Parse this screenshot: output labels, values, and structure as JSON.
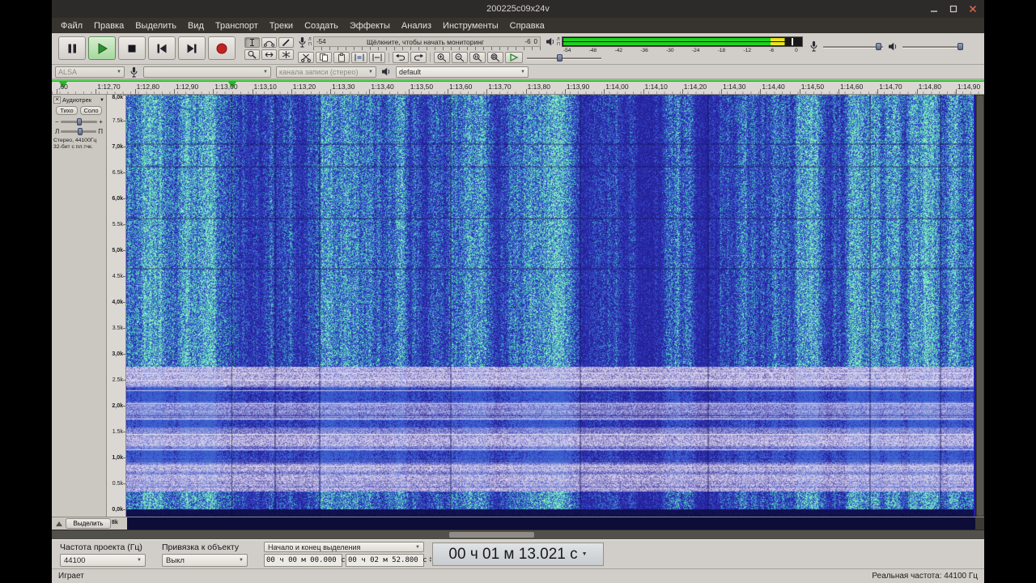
{
  "colors": {
    "play_green": "#2db52d",
    "record_red": "#c32222",
    "meter_green": "#1ed21e",
    "meter_yellow": "#e8e222"
  },
  "window": {
    "title": "200225c09x24v"
  },
  "menu": {
    "items": [
      "Файл",
      "Правка",
      "Выделить",
      "Вид",
      "Транспорт",
      "Треки",
      "Создать",
      "Эффекты",
      "Анализ",
      "Инструменты",
      "Справка"
    ]
  },
  "record_meter": {
    "channels": [
      "Л",
      "П"
    ],
    "scale_left": "-54",
    "scale_mid": "-6",
    "scale_right": "0",
    "message": "Щёлкните, чтобы начать мониторинг"
  },
  "play_meter": {
    "channels": [
      "Л",
      "П"
    ],
    "scale": [
      "-54",
      "-48",
      "-42",
      "-36",
      "-30",
      "-24",
      "-18",
      "-12",
      "-6",
      "0"
    ],
    "level_percent": 87,
    "yellow_percent": 93,
    "peak_percent": 95.5
  },
  "device_toolbar": {
    "host": "ALSA",
    "recording_channels": "канала записи (стерео)",
    "playback_device": "default"
  },
  "timeline": {
    "labels": [
      ",60",
      "1:12,70",
      "1:12,80",
      "1:12,90",
      "1:13,00",
      "1:13,10",
      "1:13,20",
      "1:13,30",
      "1:13,40",
      "1:13,50",
      "1:13,60",
      "1:13,70",
      "1:13,80",
      "1:13,90",
      "1:14,00",
      "1:14,10",
      "1:14,20",
      "1:14,30",
      "1:14,40",
      "1:14,50",
      "1:14,60",
      "1:14,70",
      "1:14,80",
      "1:14,90"
    ]
  },
  "track": {
    "name": "Аудиотрек",
    "mute_label": "Тихо",
    "solo_label": "Соло",
    "gain_min": "−",
    "gain_plus": "+",
    "pan_left": "Л",
    "pan_right": "П",
    "info_line1": "Стерео, 44100Гц",
    "info_line2": "32-бит с пл.тчк.",
    "select_label": "Выделить",
    "freq_labels": [
      "8,0k",
      "7.5k",
      "7,0k",
      "6.5k",
      "6,0k",
      "5.5k",
      "5,0k",
      "4.5k",
      "4,0k",
      "3.5k",
      "3,0k",
      "2.5k",
      "2,0k",
      "1.5k",
      "1,0k",
      "0.5k",
      "0,0k"
    ],
    "next_ruler_label": "8k"
  },
  "selection_toolbar": {
    "rate_label": "Частота проекта (Гц)",
    "rate_value": "44100",
    "snap_label": "Привязка к объекту",
    "snap_value": "Выкл",
    "range_mode": "Начало и конец выделения",
    "selection_start": "00 ч 00 м 00.000 с",
    "selection_end": "00 ч 02 м 52.800 с",
    "audio_position": "00 ч 01 м 13.021 с"
  },
  "status_bar": {
    "left": "Играет",
    "right": "Реальная частота: 44100 Гц"
  },
  "icons": {
    "dropdown": "▼",
    "close": "✕",
    "spin_up": "▲",
    "spin_down": "▼"
  }
}
